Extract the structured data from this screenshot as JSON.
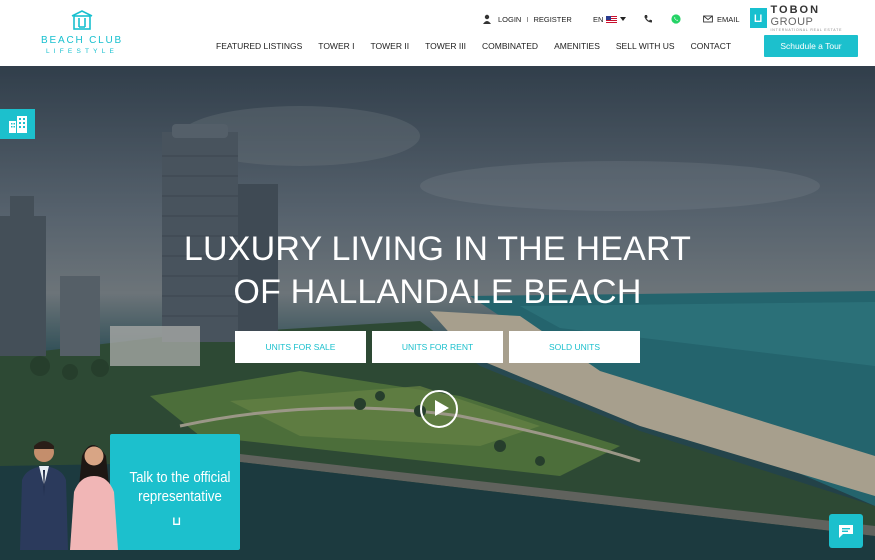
{
  "brand": {
    "logo_main": "BEACH CLUB",
    "logo_sub": "LIFESTYLE",
    "accent_color": "#1cc0cd"
  },
  "topbar": {
    "login": "LOGIN",
    "separator": "I",
    "register": "REGISTER",
    "language": "EN",
    "email": "EMAIL",
    "partner_name_bold": "TOBON",
    "partner_name_rest": "GROUP",
    "partner_tagline": "INTERNATIONAL REAL ESTATE"
  },
  "nav": {
    "items": [
      "FEATURED LISTINGS",
      "TOWER I",
      "TOWER II",
      "TOWER III",
      "COMBINATED",
      "AMENITIES",
      "SELL WITH US",
      "CONTACT"
    ],
    "schedule_tour": "Schudule a Tour"
  },
  "hero": {
    "headline_line1": "LUXURY LIVING IN THE HEART",
    "headline_line2": "OF HALLANDALE BEACH",
    "buttons": [
      "UNITS FOR SALE",
      "UNITS FOR RENT",
      "SOLD UNITS"
    ]
  },
  "representative": {
    "line1": "Talk to the official",
    "line2": "representative"
  },
  "icons": [
    "user-icon",
    "flag-us-icon",
    "phone-icon",
    "whatsapp-icon",
    "email-icon",
    "building-icon",
    "play-icon",
    "chat-icon"
  ]
}
